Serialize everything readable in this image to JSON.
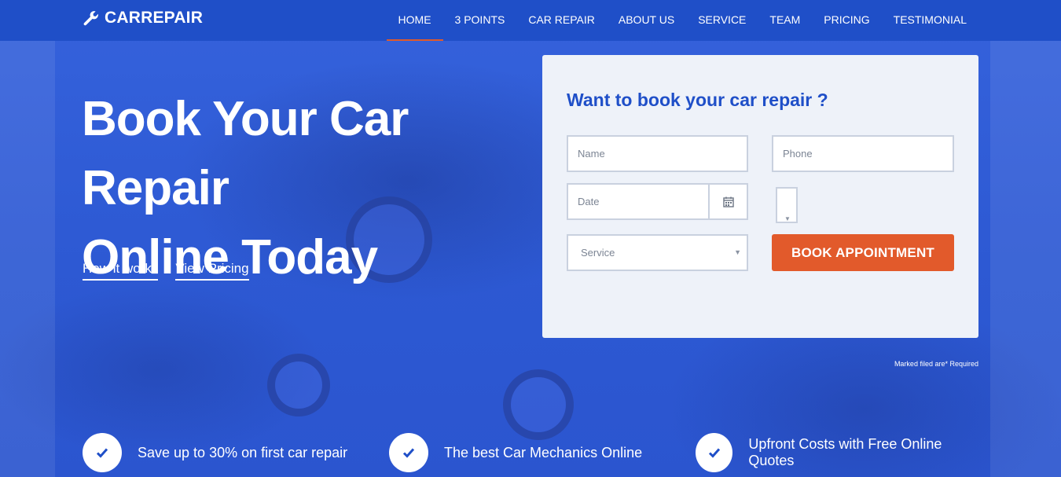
{
  "brand": {
    "name": "CARREPAIR",
    "icon": "wrench-icon"
  },
  "nav": {
    "items": [
      {
        "label": "HOME",
        "active": true
      },
      {
        "label": "3 POINTS",
        "active": false
      },
      {
        "label": "CAR REPAIR",
        "active": false
      },
      {
        "label": "ABOUT US",
        "active": false
      },
      {
        "label": "SERVICE",
        "active": false
      },
      {
        "label": "TEAM",
        "active": false
      },
      {
        "label": "PRICING",
        "active": false
      },
      {
        "label": "TESTIMONIAL",
        "active": false
      }
    ]
  },
  "hero": {
    "title_line1": "Book Your Car Repair",
    "title_line2": "Online Today",
    "links": [
      "How it works",
      "View Pricing"
    ]
  },
  "form": {
    "title": "Want to book your car repair ?",
    "name_placeholder": "Name",
    "phone_placeholder": "Phone",
    "date_placeholder": "Date",
    "service_placeholder": "Service",
    "submit_label": "BOOK APPOINTMENT",
    "note": "Marked filed are* Required"
  },
  "features": [
    {
      "label": "Save up to 30% on first car repair",
      "icon": "check-icon"
    },
    {
      "label": "The best Car Mechanics Online",
      "icon": "check-icon"
    },
    {
      "label": "Upfront Costs with Free Online Quotes",
      "icon": "check-icon"
    }
  ],
  "colors": {
    "primary": "#1f4fc8",
    "hero_bg": "#2f5bd6",
    "accent": "#e25a2b",
    "card_bg": "#eef2f9"
  }
}
